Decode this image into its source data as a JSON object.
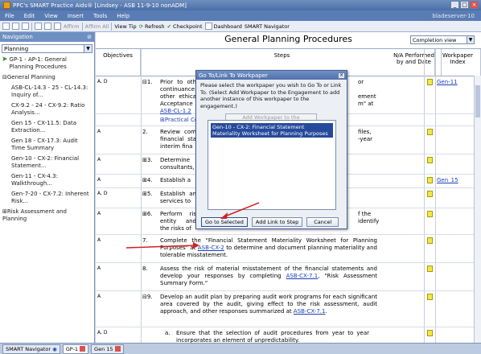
{
  "window": {
    "title": "PPC's SMART Practice Aids® [Lindsey - ASB 11-9-10 nonADM]"
  },
  "menu": {
    "items": [
      "File",
      "Edit",
      "View",
      "Insert",
      "Tools",
      "Help"
    ],
    "server": "bladeserver-10"
  },
  "toolbar": {
    "affirm": "Affirm",
    "affirm_all": "Affirm All",
    "view_tip": "View Tip",
    "refresh": "Refresh",
    "checkpoint": "Checkpoint",
    "dashboard": "Dashboard",
    "smart_navigator": "SMART Navigator"
  },
  "nav": {
    "title": "Navigation",
    "select": "Planning",
    "items": [
      {
        "label": "GP-1 - AP-1: General Planning Procedures",
        "active": true
      },
      {
        "label": "⊟General Planning",
        "group": true
      },
      {
        "label": "ASB-CL-14.3 - 25 - CL-14.3: Inquiry of..."
      },
      {
        "label": "CX-9.2 - 24 - CX-9.2: Ratio Analysis..."
      },
      {
        "label": "Gen 15 - CX-11.5: Data Extraction..."
      },
      {
        "label": "Gen 18 - CX-17.3: Audit Time Summary"
      },
      {
        "label": "Gen-10 - CX-2: Financial Statement..."
      },
      {
        "label": "Gen-11 - CX-4.3: Walkthrough..."
      },
      {
        "label": "Gen-7-20 - CX-7.2: Inherent Risk..."
      },
      {
        "label": "⊞Risk Assessment and Planning",
        "group": true
      }
    ]
  },
  "main": {
    "title": "General Planning Procedures",
    "view_select": "Completion view",
    "headers": {
      "objectives": "Objectives",
      "steps": "Steps",
      "na": "N/A Performed by and Date",
      "wp_index": "Workpaper Index"
    }
  },
  "rows": [
    {
      "obj": "A, D",
      "num": "⊟1.",
      "text": "Prior to oth continuance other ethica Acceptance",
      "link": "ASB-CL-1.2",
      "tail_a": "or",
      "tail_b": "ement",
      "tail_c": "m\" at",
      "wp": "Gen-11"
    },
    {
      "obj": "",
      "num": "",
      "text": "⊞Practical Con",
      "link": "",
      "wp": ""
    },
    {
      "obj": "A",
      "num": "2.",
      "text": "Review com financial sta interim fina",
      "tail_a": "files,",
      "tail_b": "-year",
      "wp": ""
    },
    {
      "obj": "A",
      "num": "⊞3.",
      "text": "Determine consultants,",
      "wp": ""
    },
    {
      "obj": "A",
      "num": "⊞4.",
      "text": "Establish a",
      "wp": "Gen_15"
    },
    {
      "obj": "A, D",
      "num": "⊞5.",
      "text": "Establish an services to",
      "wp": ""
    },
    {
      "obj": "A",
      "num": "⊞6.",
      "text": "Perform ris entity and the risks of",
      "tail_a": "f the",
      "tail_b": "identify",
      "wp": ""
    },
    {
      "obj": "A",
      "num": "7.",
      "text_pre": "Complete the \"Financial Statement Materiality Worksheet for Planning Purposes\" at",
      "link": "ASB-CX-2",
      "text_post": "to determine and document planning materiality and tolerable misstatement.",
      "wp": ""
    },
    {
      "obj": "A",
      "num": "8.",
      "text_pre": "Assess the risk of material misstatement of the financial statements and develop your responses by completing",
      "link": "ASB-CX-7.1",
      "text_post": ", \"Risk Assessment Summary Form.\"",
      "wp": ""
    },
    {
      "obj": "A",
      "num": "⊟9.",
      "text_pre": "Develop an audit plan by preparing audit work programs for each significant area covered by the audit, giving effect to the risk assessment, audit approach, and other responses summarized at",
      "link": "ASB-CX-7.1",
      "text_post": ".",
      "wp": ""
    },
    {
      "obj": "A, D",
      "num": "a.",
      "text": "Ensure that the selection of audit procedures from year to year incorporates an element of unpredictability.",
      "wp": ""
    }
  ],
  "dialog": {
    "title": "Go To/Link To Workpaper",
    "text": "Please select the workpaper you wish to Go To or Link To. (Select Add Workpaper to the Engagement to add another instance of this workpaper to the engagement.)",
    "add_btn": "Add Workpaper to the Engagement",
    "list_item": "Gen-10 - CX-2: Financial Statement Materiality Worksheet for Planning Purposes",
    "btn_goto": "Go to Selected",
    "btn_link": "Add Link to Step",
    "btn_cancel": "Cancel"
  },
  "status": {
    "tabs": [
      "SMART Navigator",
      "GP-1",
      "Gen 15"
    ]
  }
}
